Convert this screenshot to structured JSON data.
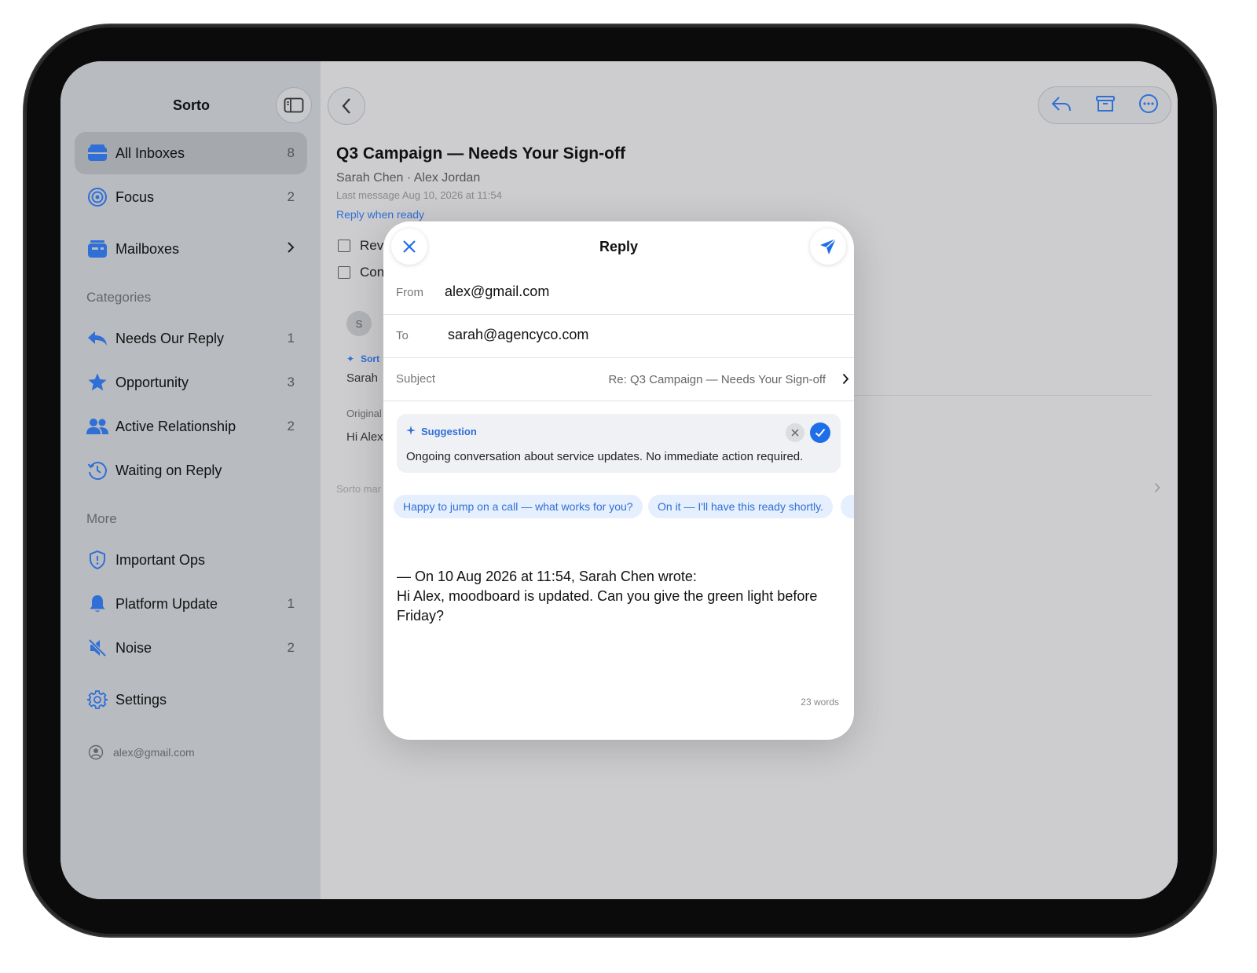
{
  "sidebar": {
    "title": "Sorto",
    "items": [
      {
        "label": "All Inboxes",
        "count": "8",
        "icon": "tray-icon"
      },
      {
        "label": "Focus",
        "count": "2",
        "icon": "target-icon"
      },
      {
        "label": "Mailboxes",
        "icon": "mailbox-icon"
      }
    ],
    "categories_label": "Categories",
    "categories": [
      {
        "label": "Needs Our Reply",
        "count": "1",
        "icon": "reply-icon"
      },
      {
        "label": "Opportunity",
        "count": "3",
        "icon": "star-icon"
      },
      {
        "label": "Active Relationship",
        "count": "2",
        "icon": "people-icon"
      },
      {
        "label": "Waiting on Reply",
        "icon": "clock-history-icon"
      }
    ],
    "more_label": "More",
    "more": [
      {
        "label": "Important Ops",
        "icon": "shield-icon"
      },
      {
        "label": "Platform Update",
        "count": "1",
        "icon": "bell-icon"
      },
      {
        "label": "Noise",
        "count": "2",
        "icon": "speaker-mute-icon"
      }
    ],
    "settings_label": "Settings",
    "account": "alex@gmail.com"
  },
  "thread": {
    "title": "Q3 Campaign — Needs Your Sign-off",
    "participants": "Sarah Chen · Alex Jordan",
    "last_message": "Last message Aug 10, 2026 at 11:54",
    "status": "Reply when ready",
    "tasks": [
      "Rev",
      "Con"
    ],
    "avatar_letter": "S",
    "fragments": {
      "sorto": "Sort",
      "sarah": "Sarah",
      "original": "Original",
      "hi": "Hi Alex,",
      "footer": "Sorto mar"
    }
  },
  "reply": {
    "title": "Reply",
    "from_label": "From",
    "from_value": "alex@gmail.com",
    "to_label": "To",
    "to_value": "sarah@agencyco.com",
    "subject_label": "Subject",
    "subject_value": "Re: Q3 Campaign — Needs Your Sign-off",
    "suggestion_label": "Suggestion",
    "suggestion_text": "Ongoing conversation about service updates. No immediate action required.",
    "chips": [
      "Happy to jump on a call — what works for you?",
      "On it — I'll have this ready shortly."
    ],
    "quote_header": "— On 10 Aug 2026 at 11:54, Sarah Chen wrote:",
    "quote_body": "Hi Alex, moodboard is updated. Can you give the green light before Friday?",
    "word_count": "23 words"
  },
  "colors": {
    "accent": "#1e6ee8",
    "sidebar_bg": "#b8bbc0",
    "content_bg": "#cdcdcf"
  }
}
